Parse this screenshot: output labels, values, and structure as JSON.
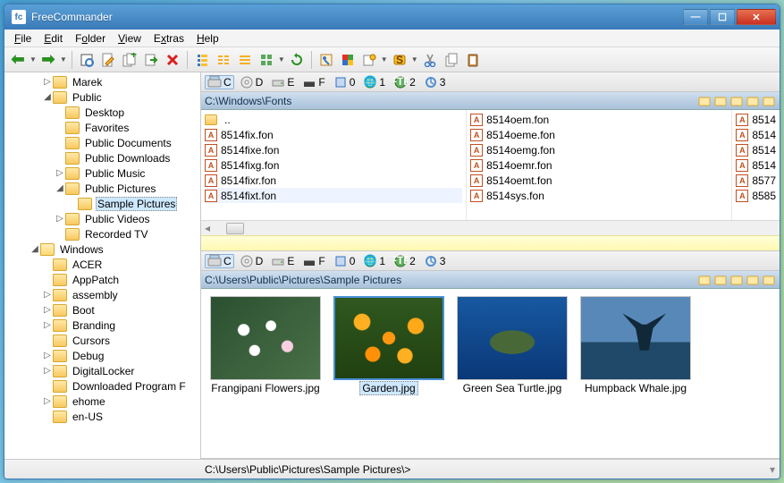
{
  "window": {
    "title": "FreeCommander"
  },
  "menu": {
    "file": "File",
    "edit": "Edit",
    "folder": "Folder",
    "view": "View",
    "extras": "Extras",
    "help": "Help"
  },
  "tree": [
    {
      "indent": 3,
      "twisty": "▷",
      "label": "Marek"
    },
    {
      "indent": 3,
      "twisty": "◢",
      "label": "Public"
    },
    {
      "indent": 4,
      "twisty": "",
      "label": "Desktop",
      "special": true
    },
    {
      "indent": 4,
      "twisty": "",
      "label": "Favorites"
    },
    {
      "indent": 4,
      "twisty": "",
      "label": "Public Documents"
    },
    {
      "indent": 4,
      "twisty": "",
      "label": "Public Downloads"
    },
    {
      "indent": 4,
      "twisty": "▷",
      "label": "Public Music"
    },
    {
      "indent": 4,
      "twisty": "◢",
      "label": "Public Pictures"
    },
    {
      "indent": 5,
      "twisty": "",
      "label": "Sample Pictures",
      "selected": true
    },
    {
      "indent": 4,
      "twisty": "▷",
      "label": "Public Videos"
    },
    {
      "indent": 4,
      "twisty": "",
      "label": "Recorded TV"
    },
    {
      "indent": 2,
      "twisty": "◢",
      "label": "Windows",
      "open": true
    },
    {
      "indent": 3,
      "twisty": "",
      "label": "ACER"
    },
    {
      "indent": 3,
      "twisty": "",
      "label": "AppPatch"
    },
    {
      "indent": 3,
      "twisty": "▷",
      "label": "assembly"
    },
    {
      "indent": 3,
      "twisty": "▷",
      "label": "Boot"
    },
    {
      "indent": 3,
      "twisty": "▷",
      "label": "Branding"
    },
    {
      "indent": 3,
      "twisty": "",
      "label": "Cursors"
    },
    {
      "indent": 3,
      "twisty": "▷",
      "label": "Debug"
    },
    {
      "indent": 3,
      "twisty": "▷",
      "label": "DigitalLocker"
    },
    {
      "indent": 3,
      "twisty": "",
      "label": "Downloaded Program F"
    },
    {
      "indent": 3,
      "twisty": "▷",
      "label": "ehome"
    },
    {
      "indent": 3,
      "twisty": "",
      "label": "en-US"
    }
  ],
  "drives": {
    "items": [
      {
        "letter": "C",
        "active": true
      },
      {
        "letter": "D"
      },
      {
        "letter": "E"
      },
      {
        "letter": "F"
      },
      {
        "letter": "0"
      },
      {
        "letter": "1"
      },
      {
        "letter": "2"
      },
      {
        "letter": "3"
      }
    ]
  },
  "panes": {
    "top": {
      "path": "C:\\Windows\\Fonts",
      "col1": [
        "..",
        "8514fix.fon",
        "8514fixe.fon",
        "8514fixg.fon",
        "8514fixr.fon",
        "8514fixt.fon"
      ],
      "col1_selected_index": 5,
      "col2": [
        "8514oem.fon",
        "8514oeme.fon",
        "8514oemg.fon",
        "8514oemr.fon",
        "8514oemt.fon",
        "8514sys.fon"
      ],
      "col3": [
        "8514",
        "8514",
        "8514",
        "8514",
        "8577",
        "8585"
      ]
    },
    "bottom": {
      "path": "C:\\Users\\Public\\Pictures\\Sample Pictures",
      "thumbs": [
        {
          "label": "Frangipani Flowers.jpg",
          "cls": "img-frangipani"
        },
        {
          "label": "Garden.jpg",
          "cls": "img-garden",
          "selected": true
        },
        {
          "label": "Green Sea Turtle.jpg",
          "cls": "img-turtle"
        },
        {
          "label": "Humpback Whale.jpg",
          "cls": "img-whale"
        }
      ]
    }
  },
  "statusbar": {
    "text": "C:\\Users\\Public\\Pictures\\Sample Pictures\\>"
  }
}
